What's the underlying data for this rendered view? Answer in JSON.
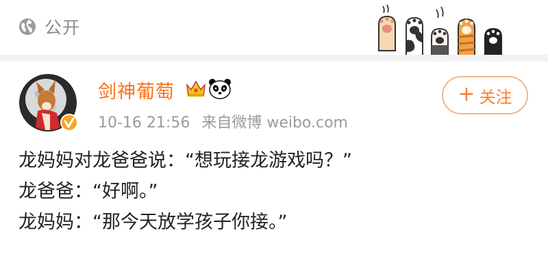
{
  "header": {
    "privacy_icon": "globe-icon",
    "privacy_label": "公开",
    "decoration_icon": "cat-paws-icon"
  },
  "post": {
    "author": {
      "name": "剑神葡萄",
      "avatar_icon": "corgi-avatar",
      "verified_badge_icon": "verified-badge-icon",
      "badges": [
        "crown-icon",
        "panda-icon"
      ]
    },
    "timestamp": "10-16 21:56",
    "source": "来自微博 weibo.com",
    "follow_button": {
      "icon": "plus-icon",
      "plus": "+",
      "label": "关注"
    },
    "content_lines": [
      "龙妈妈对龙爸爸说：“想玩接龙游戏吗？”",
      "龙爸爸：“好啊。”",
      "龙妈妈：“那今天放学孩子你接。”"
    ]
  },
  "colors": {
    "username": "#ff6f1a",
    "follow": "#ff7d2a",
    "meta_text": "#9b9b9b",
    "divider": "#f2f2f2"
  }
}
